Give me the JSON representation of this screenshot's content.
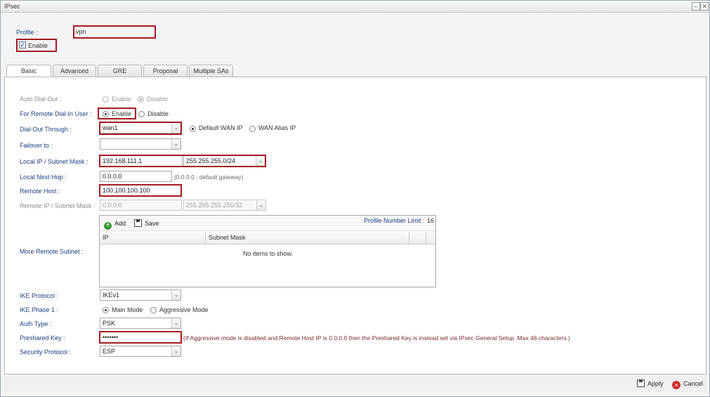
{
  "window": {
    "title": "IPsec",
    "min_glyph": "–",
    "close_glyph": "✕"
  },
  "profile": {
    "label": "Profile :",
    "value": "vpn"
  },
  "enable": {
    "label": "Enable",
    "checked": true,
    "check_glyph": "✓"
  },
  "tabs": [
    {
      "label": "Basic",
      "active": true
    },
    {
      "label": "Advanced",
      "active": false
    },
    {
      "label": "GRE",
      "active": false
    },
    {
      "label": "Proposal",
      "active": false
    },
    {
      "label": "Multiple SAs",
      "active": false
    }
  ],
  "form": {
    "auto_dial_out": {
      "label": "Auto Dial-Out :",
      "opt_enable": "Enable",
      "opt_disable": "Disable",
      "selected": "Disable"
    },
    "remote_dial_in": {
      "label": "For Remote Dial-In User :",
      "opt_enable": "Enable",
      "opt_disable": "Disable",
      "selected": "Enable"
    },
    "dial_out_through": {
      "label": "Dial-Out Through :",
      "value": "wan1",
      "opt_default": "Default WAN IP",
      "opt_alias": "WAN Alias IP",
      "selected": "Default WAN IP"
    },
    "failover": {
      "label": "Failover to :",
      "value": ""
    },
    "local_ip": {
      "label": "Local IP / Subnet Mask :",
      "ip": "192.168.111.1",
      "mask": "255.255.255.0/24"
    },
    "local_next_hop": {
      "label": "Local Next Hop :",
      "value": "0.0.0.0",
      "hint": "(0.0.0.0 : default gateway)"
    },
    "remote_host": {
      "label": "Remote Host :",
      "value": "100.100.100.100"
    },
    "remote_ip": {
      "label": "Remote IP / Subnet Mask :",
      "ip": "0.0.0.0",
      "mask": "255.255.255.255/32"
    },
    "more_remote_subnet": {
      "label": "More Remote Subnet :",
      "add_label": "Add",
      "save_label": "Save",
      "limit_label": "Profile Number Limit :",
      "limit_value": "16",
      "columns": [
        "IP",
        "Subnet Mask"
      ],
      "empty_text": "No items to show."
    },
    "ike_protocol": {
      "label": "IKE Protocol :",
      "value": "IKEv1"
    },
    "ike_phase1": {
      "label": "IKE Phase 1 :",
      "opt_main": "Main Mode",
      "opt_aggressive": "Aggressive Mode",
      "selected": "Main Mode"
    },
    "auth_type": {
      "label": "Auth Type :",
      "value": "PSK"
    },
    "preshared_key": {
      "label": "Preshared Key :",
      "value": "•••••••",
      "note": "(If Aggressive mode is disabled and Remote Host IP is 0.0.0.0 then the Preshared Key is instead set via IPsec General Setup. Max 46 characters.)"
    },
    "security_protocol": {
      "label": "Security Protocol :",
      "value": "ESP"
    }
  },
  "footer": {
    "apply_label": "Apply",
    "cancel_label": "Cancel"
  },
  "icons": {
    "dropdown": "⌄",
    "add": "+",
    "cancel": "×"
  },
  "colors": {
    "label_blue": "#1c3f80",
    "highlight_red": "#a41c22",
    "note_red": "#7a2a2a"
  }
}
